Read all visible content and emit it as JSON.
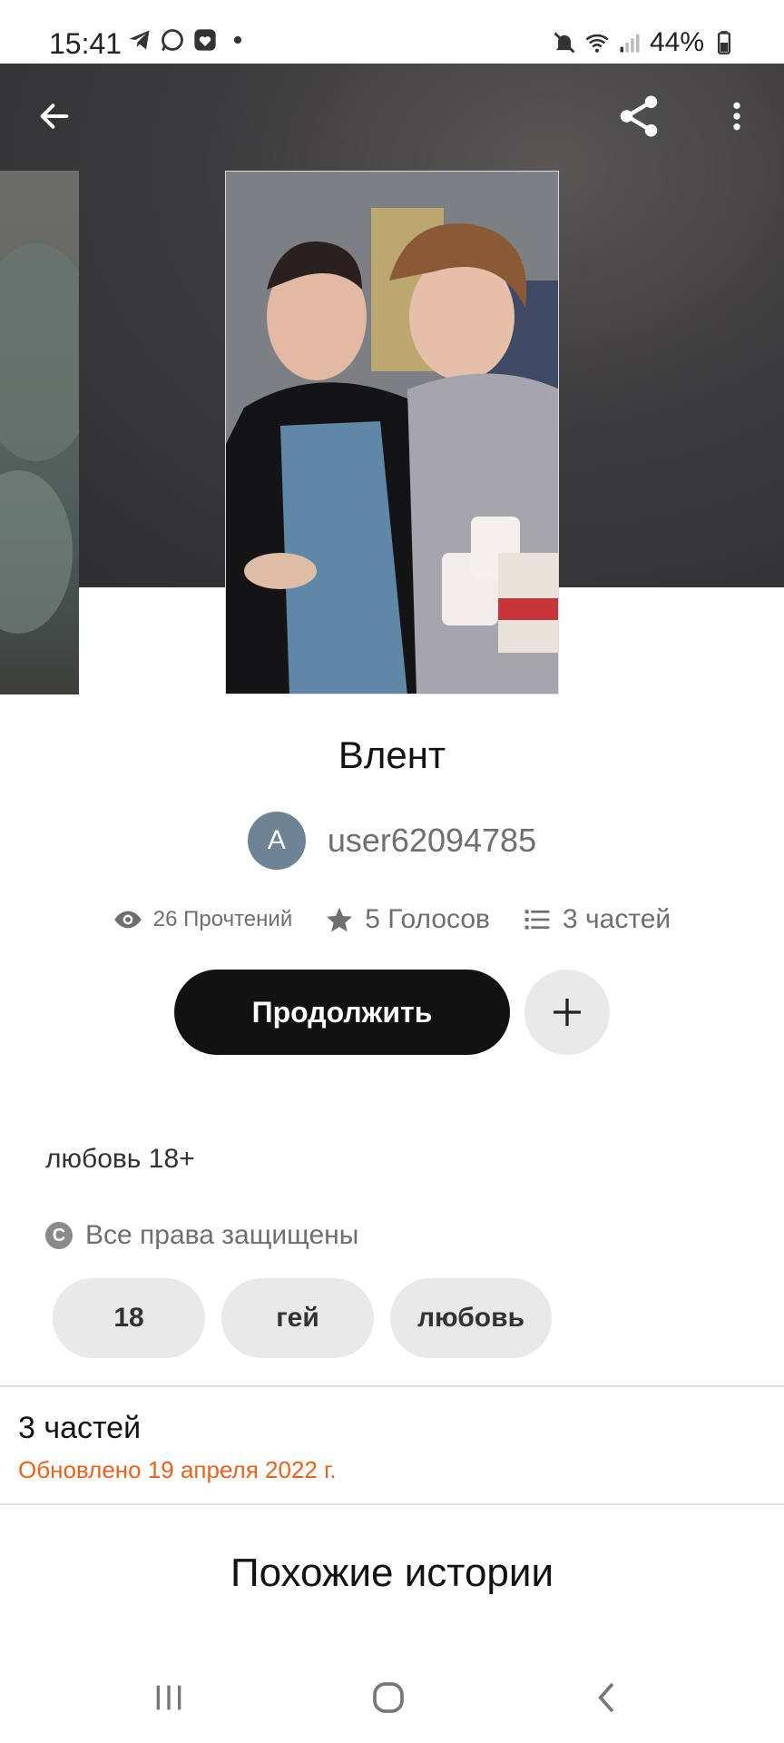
{
  "status_bar": {
    "time": "15:41",
    "battery": "44%",
    "left_icons": [
      "telegram-icon",
      "whatsapp-icon",
      "app-heart-icon",
      "dot-icon"
    ],
    "right_icons": [
      "mute-icon",
      "wifi-icon",
      "signal-icon",
      "battery-icon"
    ]
  },
  "header": {
    "back_icon": "arrow-left-icon",
    "share_icon": "share-icon",
    "more_icon": "more-vertical-icon"
  },
  "story": {
    "title": "Влент",
    "author": {
      "initial": "A",
      "name": "user62094785"
    },
    "stats": {
      "reads": "26 Прочтений",
      "votes": "5 Голосов",
      "parts": "3 частей"
    },
    "continue_label": "Продолжить",
    "description": "любовь 18+",
    "copyright": "Все права защищены",
    "tags": [
      "18",
      "гей",
      "любовь"
    ]
  },
  "parts_section": {
    "title": "3 частей",
    "updated": "Обновлено 19 апреля 2022 г."
  },
  "similar_section": {
    "title": "Похожие истории"
  },
  "colors": {
    "accent_orange": "#e8641c",
    "button_dark": "#121212",
    "chip_gray": "#e9e9e9",
    "avatar": "#6e8394"
  }
}
